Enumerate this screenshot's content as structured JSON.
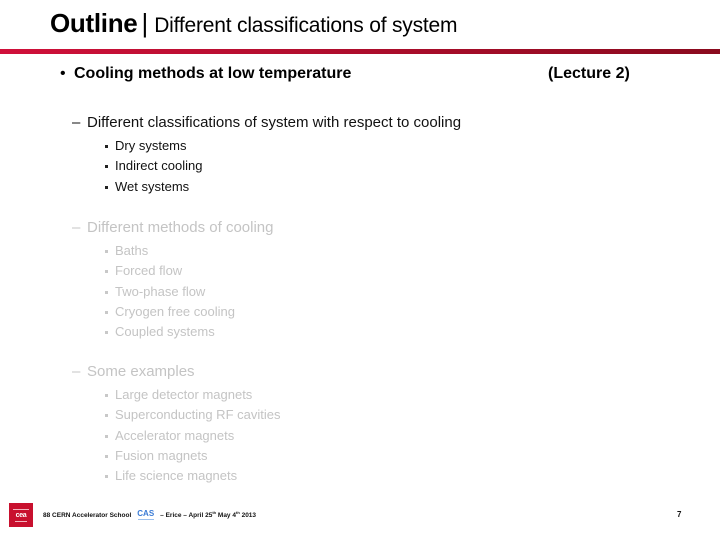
{
  "header": {
    "title_main": "Outline",
    "title_separator": "|",
    "title_sub": "Different classifications of system",
    "bar_colors": {
      "start": "#d0103a",
      "end": "#8a0a1e"
    }
  },
  "content": {
    "main_bullet": {
      "symbol": "•",
      "text": "Cooling methods at low temperature",
      "note": "(Lecture 2)"
    },
    "sections": [
      {
        "dash": "–",
        "heading": "Different classifications of system with respect to cooling",
        "state": "active",
        "items": [
          "Dry systems",
          "Indirect cooling",
          "Wet systems"
        ]
      },
      {
        "dash": "–",
        "heading": "Different methods of cooling",
        "state": "dimmed",
        "items": [
          "Baths",
          "Forced flow",
          "Two-phase flow",
          "Cryogen free cooling",
          "Coupled systems"
        ]
      },
      {
        "dash": "–",
        "heading": "Some examples",
        "state": "dimmed",
        "items": [
          "Large detector magnets",
          "Superconducting RF cavities",
          "Accelerator magnets",
          "Fusion magnets",
          "Life science magnets"
        ]
      }
    ],
    "colors": {
      "active_text": "#111111",
      "dimmed_text": "#c4c4c4",
      "accent_red": "#c8102e"
    }
  },
  "footer": {
    "logo_icon": "cea-logo-icon",
    "logo_text": "cea",
    "school_text": "88 CERN Accelerator School",
    "cas_logo_text": "CAS",
    "location_text": "– Erice – April 25",
    "start_sup": "th",
    "end_text": "May 4",
    "end_sup": "th",
    "year": "2013",
    "page_number": "7"
  }
}
